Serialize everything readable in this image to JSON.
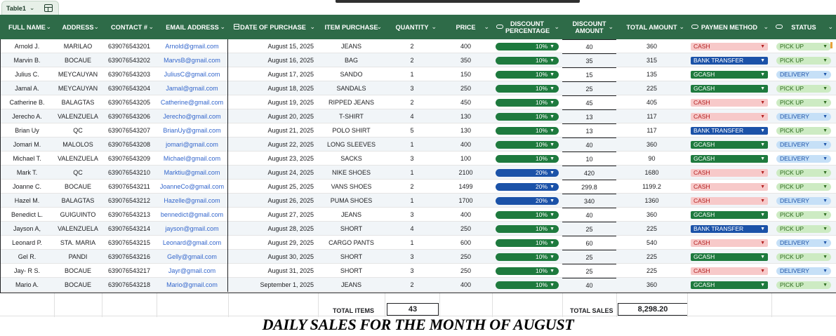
{
  "tab": {
    "label": "Table1"
  },
  "columns": [
    {
      "key": "name",
      "label": "FULL NAME",
      "width": 77,
      "chev": true,
      "icon": ""
    },
    {
      "key": "address",
      "label": "ADDRESS",
      "width": 68,
      "chev": true,
      "icon": ""
    },
    {
      "key": "contact",
      "label": "CONTACT #",
      "width": 78,
      "chev": true,
      "icon": ""
    },
    {
      "key": "email",
      "label": "EMAIL ADDRESS",
      "width": 102,
      "chev": true,
      "icon": ""
    },
    {
      "key": "date",
      "label": "DATE OF PURCHASE",
      "width": 128,
      "chev": true,
      "icon": "calendar"
    },
    {
      "key": "item",
      "label": "ITEM PURCHASE",
      "width": 95,
      "chev": true,
      "icon": ""
    },
    {
      "key": "qty",
      "label": "QUANTITY",
      "width": 78,
      "chev": true,
      "icon": ""
    },
    {
      "key": "price",
      "label": "PRICE",
      "width": 75,
      "chev": true,
      "icon": ""
    },
    {
      "key": "disc_pct",
      "label": "DISCOUNT PERCENTAGE",
      "width": 100,
      "chev": true,
      "icon": "chip"
    },
    {
      "key": "disc_amt",
      "label": "DISCOUNT AMOUNT",
      "width": 77,
      "chev": true,
      "icon": ""
    },
    {
      "key": "total",
      "label": "TOTAL AMOUNT",
      "width": 101,
      "chev": true,
      "icon": ""
    },
    {
      "key": "pay",
      "label": "PAYMEN METHOD",
      "width": 120,
      "chev": true,
      "icon": "chip"
    },
    {
      "key": "status",
      "label": "STATUS",
      "width": 92,
      "chev": true,
      "icon": "chip"
    }
  ],
  "rows": [
    {
      "name": "Arnold J.",
      "address": "MARILAO",
      "contact": "639076543201",
      "email": "Arnold@gmail.com",
      "date": "August 15, 2025",
      "item": "JEANS",
      "qty": "2",
      "price": "400",
      "disc_pct": "10%",
      "disc_amt": "40",
      "total": "360",
      "pay": "CASH",
      "status": "PICK UP"
    },
    {
      "name": "Marvin B.",
      "address": "BOCAUE",
      "contact": "639076543202",
      "email": "MarvsB@gmail.com",
      "date": "August 16, 2025",
      "item": "BAG",
      "qty": "2",
      "price": "350",
      "disc_pct": "10%",
      "disc_amt": "35",
      "total": "315",
      "pay": "BANK TRANSFER",
      "status": "PICK UP"
    },
    {
      "name": "Julius C.",
      "address": "MEYCAUYAN",
      "contact": "639076543203",
      "email": "JuliusC@gmail.com",
      "date": "August 17, 2025",
      "item": "SANDO",
      "qty": "1",
      "price": "150",
      "disc_pct": "10%",
      "disc_amt": "15",
      "total": "135",
      "pay": "GCASH",
      "status": "DELIVERY"
    },
    {
      "name": "Jamal A.",
      "address": "MEYCAUYAN",
      "contact": "639076543204",
      "email": "Jamal@gmail.com",
      "date": "August 18, 2025",
      "item": "SANDALS",
      "qty": "3",
      "price": "250",
      "disc_pct": "10%",
      "disc_amt": "25",
      "total": "225",
      "pay": "GCASH",
      "status": "PICK UP"
    },
    {
      "name": "Catherine B.",
      "address": "BALAGTAS",
      "contact": "639076543205",
      "email": "Catherine@gmail.com",
      "date": "August 19, 2025",
      "item": "RIPPED JEANS",
      "qty": "2",
      "price": "450",
      "disc_pct": "10%",
      "disc_amt": "45",
      "total": "405",
      "pay": "CASH",
      "status": "PICK UP"
    },
    {
      "name": "Jerecho A.",
      "address": "VALENZUELA",
      "contact": "639076543206",
      "email": "Jerecho@gmail.com",
      "date": "August 20, 2025",
      "item": "T-SHIRT",
      "qty": "4",
      "price": "130",
      "disc_pct": "10%",
      "disc_amt": "13",
      "total": "117",
      "pay": "CASH",
      "status": "DELIVERY"
    },
    {
      "name": "Brian Uy",
      "address": "QC",
      "contact": "639076543207",
      "email": "BrianUy@gmail.com",
      "date": "August 21, 2025",
      "item": "POLO SHIRT",
      "qty": "5",
      "price": "130",
      "disc_pct": "10%",
      "disc_amt": "13",
      "total": "117",
      "pay": "BANK TRANSFER",
      "status": "PICK UP"
    },
    {
      "name": "Jomari M.",
      "address": "MALOLOS",
      "contact": "639076543208",
      "email": "jomari@gmail.com",
      "date": "August 22, 2025",
      "item": "LONG SLEEVES",
      "qty": "1",
      "price": "400",
      "disc_pct": "10%",
      "disc_amt": "40",
      "total": "360",
      "pay": "GCASH",
      "status": "DELIVERY"
    },
    {
      "name": "Michael T.",
      "address": "VALENZUELA",
      "contact": "639076543209",
      "email": "Michael@gmail.com",
      "date": "August 23, 2025",
      "item": "SACKS",
      "qty": "3",
      "price": "100",
      "disc_pct": "10%",
      "disc_amt": "10",
      "total": "90",
      "pay": "GCASH",
      "status": "DELIVERY"
    },
    {
      "name": "Mark T.",
      "address": "QC",
      "contact": "639076543210",
      "email": "Marktiu@gmail.com",
      "date": "August 24, 2025",
      "item": "NIKE SHOES",
      "qty": "1",
      "price": "2100",
      "disc_pct": "20%",
      "disc_amt": "420",
      "total": "1680",
      "pay": "CASH",
      "status": "PICK UP"
    },
    {
      "name": "Joanne C.",
      "address": "BOCAUE",
      "contact": "639076543211",
      "email": "JoanneCo@gmail.com",
      "date": "August 25, 2025",
      "item": "VANS SHOES",
      "qty": "2",
      "price": "1499",
      "disc_pct": "20%",
      "disc_amt": "299.8",
      "total": "1199.2",
      "pay": "CASH",
      "status": "PICK UP"
    },
    {
      "name": "Hazel M.",
      "address": "BALAGTAS",
      "contact": "639076543212",
      "email": "Hazelle@gmail.com",
      "date": "August 26, 2025",
      "item": "PUMA SHOES",
      "qty": "1",
      "price": "1700",
      "disc_pct": "20%",
      "disc_amt": "340",
      "total": "1360",
      "pay": "CASH",
      "status": "DELIVERY"
    },
    {
      "name": "Benedict L.",
      "address": "GUIGUINTO",
      "contact": "639076543213",
      "email": "bennedict@gmail.com",
      "date": "August 27, 2025",
      "item": "JEANS",
      "qty": "3",
      "price": "400",
      "disc_pct": "10%",
      "disc_amt": "40",
      "total": "360",
      "pay": "GCASH",
      "status": "PICK UP"
    },
    {
      "name": "Jayson A,",
      "address": "VALENZUELA",
      "contact": "639076543214",
      "email": "jayson@gmail.com",
      "date": "August 28, 2025",
      "item": "SHORT",
      "qty": "4",
      "price": "250",
      "disc_pct": "10%",
      "disc_amt": "25",
      "total": "225",
      "pay": "BANK TRANSFER",
      "status": "PICK UP"
    },
    {
      "name": "Leonard P.",
      "address": "STA. MARIA",
      "contact": "639076543215",
      "email": "Leonard@gmail.com",
      "date": "August 29, 2025",
      "item": "CARGO PANTS",
      "qty": "1",
      "price": "600",
      "disc_pct": "10%",
      "disc_amt": "60",
      "total": "540",
      "pay": "CASH",
      "status": "DELIVERY"
    },
    {
      "name": "Gel R.",
      "address": "PANDI",
      "contact": "639076543216",
      "email": "Gelly@gmail.com",
      "date": "August 30, 2025",
      "item": "SHORT",
      "qty": "3",
      "price": "250",
      "disc_pct": "10%",
      "disc_amt": "25",
      "total": "225",
      "pay": "GCASH",
      "status": "PICK UP"
    },
    {
      "name": "Jay- R S.",
      "address": "BOCAUE",
      "contact": "639076543217",
      "email": "Jayr@gmail.com",
      "date": "August 31, 2025",
      "item": "SHORT",
      "qty": "3",
      "price": "250",
      "disc_pct": "10%",
      "disc_amt": "25",
      "total": "225",
      "pay": "CASH",
      "status": "DELIVERY"
    },
    {
      "name": "Mario A.",
      "address": "BOCAUE",
      "contact": "639076543218",
      "email": "Mario@gmail.com",
      "date": "September 1, 2025",
      "item": "JEANS",
      "qty": "2",
      "price": "400",
      "disc_pct": "10%",
      "disc_amt": "40",
      "total": "360",
      "pay": "GCASH",
      "status": "PICK UP"
    }
  ],
  "totals": {
    "items_label": "TOTAL ITEMS",
    "items_value": "43",
    "sales_label": "TOTAL SALES",
    "sales_value": "8,298.20"
  },
  "banner": "DAILY SALES FOR THE MONTH OF AUGUST",
  "colors": {
    "header_bg": "#2e6b48",
    "pill_green": "#1e7a3e",
    "pill_blue": "#1b52a8",
    "cash_bg": "#f7c9c9",
    "pickup_bg": "#cdebc3",
    "delivery_bg": "#c6e0f7"
  }
}
